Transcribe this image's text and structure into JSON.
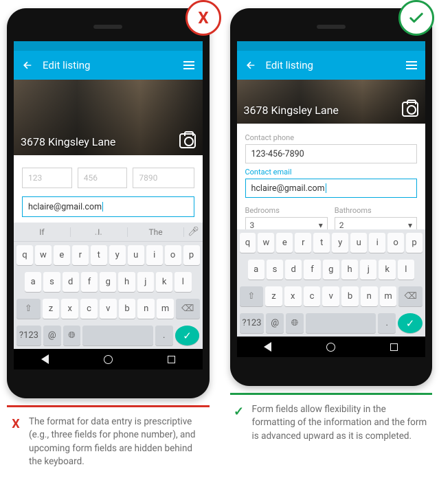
{
  "badges": {
    "bad": "X",
    "good": "✓"
  },
  "appbar": {
    "title": "Edit listing"
  },
  "address": "3678 Kingsley Lane",
  "left": {
    "phone_parts": {
      "p1": "123",
      "p2": "456",
      "p3": "7890"
    },
    "email_value": "hclaire@gmail.com",
    "suggestions": {
      "s1": "If",
      "s2": "I",
      "s3": "The"
    }
  },
  "right": {
    "phone_label": "Contact phone",
    "phone_value": "123-456-7890",
    "email_label": "Contact email",
    "email_value": "hclaire@gmail.com",
    "bedrooms_label": "Bedrooms",
    "bedrooms_value": "3",
    "bathrooms_label": "Bathrooms",
    "bathrooms_value": "2"
  },
  "keyboard": {
    "row1": [
      "q",
      "w",
      "e",
      "r",
      "t",
      "y",
      "u",
      "i",
      "o",
      "p"
    ],
    "row2": [
      "a",
      "s",
      "d",
      "f",
      "g",
      "h",
      "j",
      "k",
      "l"
    ],
    "row3": [
      "z",
      "x",
      "c",
      "v",
      "b",
      "n",
      "m"
    ],
    "numkey": "?123",
    "at": "@",
    "dot": "."
  },
  "captions": {
    "bad_icon": "X",
    "bad": "The format for data entry is prescriptive (e.g., three fields for phone number), and upcoming form fields are hidden behind the keyboard.",
    "good_icon": "✓",
    "good": "Form fields allow flexibility in the formatting of the information and the form is advanced upward as it is completed."
  }
}
